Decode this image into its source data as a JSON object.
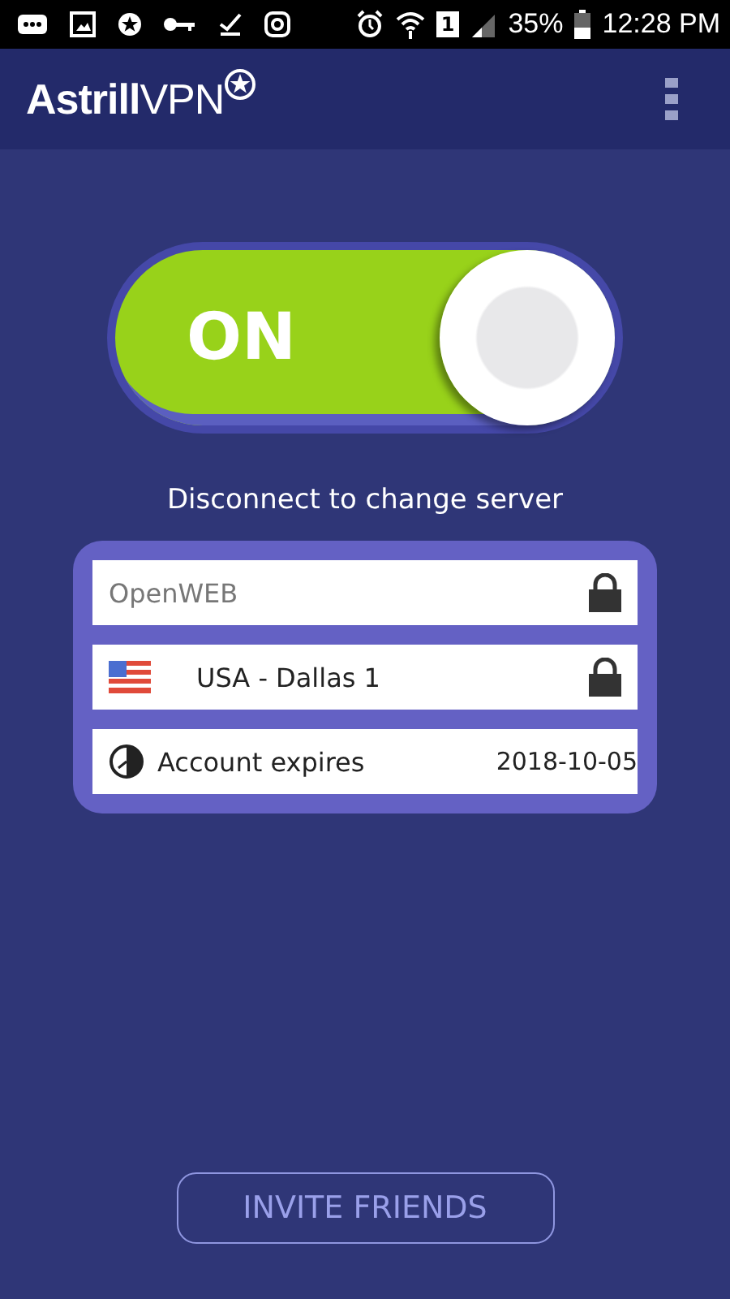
{
  "status_bar": {
    "sim": "1",
    "battery": "35%",
    "time": "12:28 PM"
  },
  "header": {
    "logo": "**Astrill**VPN"
  },
  "toggle": {
    "on": true,
    "label": "ON"
  },
  "hint": "Disconnect to change server",
  "rows": [
    {
      "kind": "mode",
      "text": "OpenWEB",
      "locked": true
    },
    {
      "kind": "server",
      "text": "USA - Dallas 1",
      "locked": true
    },
    {
      "kind": "expiry",
      "text": "Account expires",
      "value": "2018-10-05"
    }
  ],
  "invite_button": "INVITE FRIENDS"
}
